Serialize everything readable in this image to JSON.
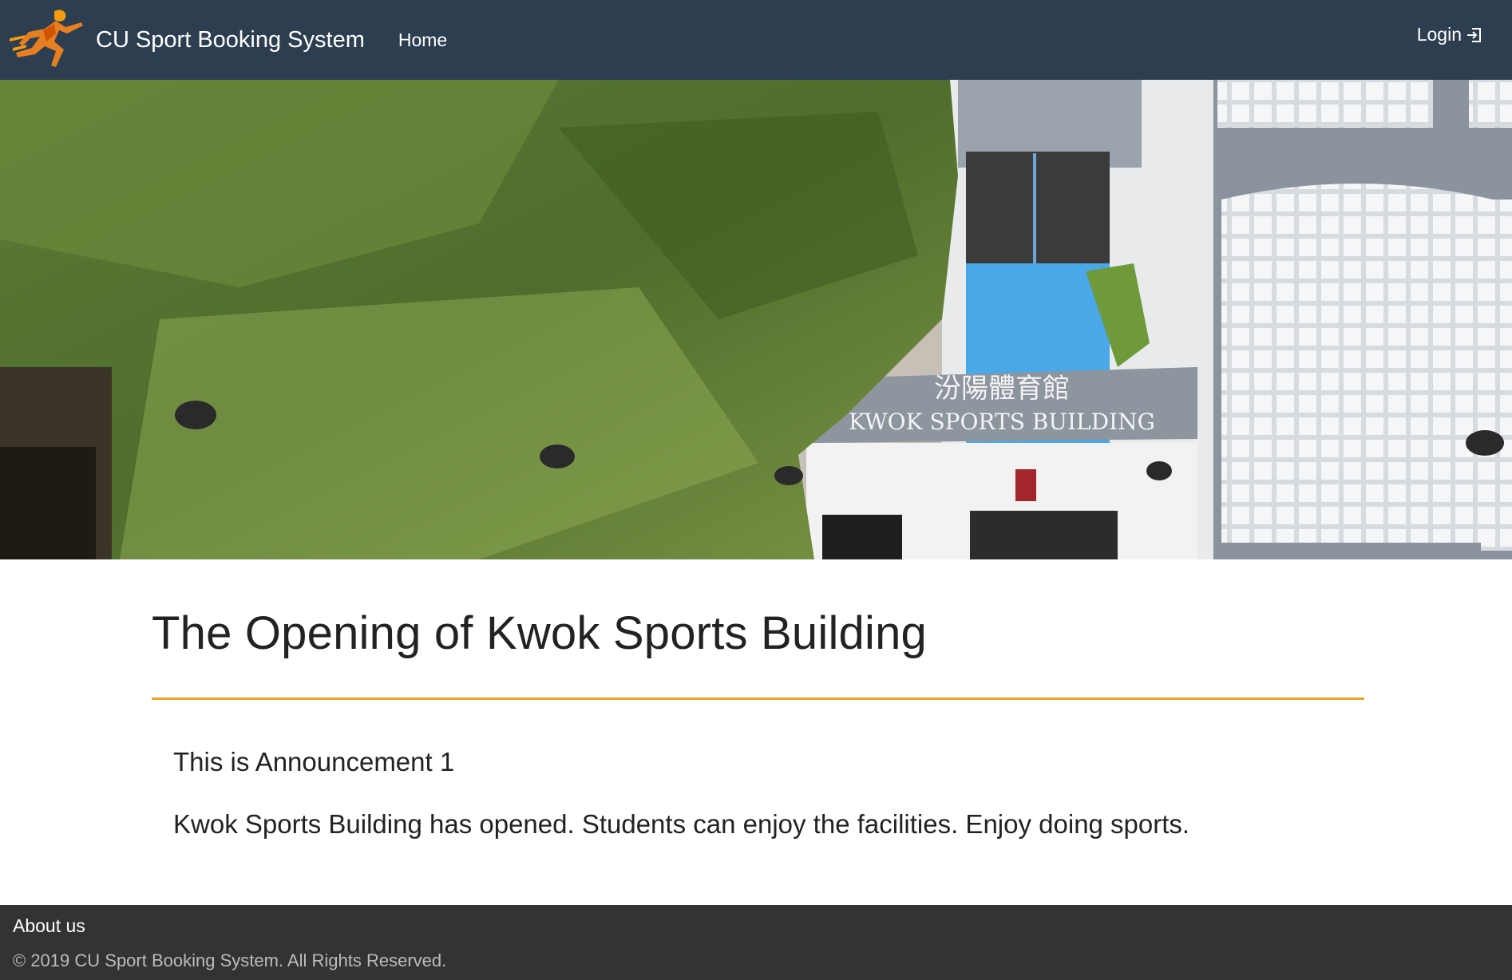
{
  "navbar": {
    "brand_title": "CU Sport Booking System",
    "home_label": "Home",
    "login_label": "Login",
    "login_icon": "sign-in-icon",
    "logo_icon": "running-man-logo"
  },
  "hero": {
    "sign_chinese": "汾陽體育館",
    "sign_english": "KWOK SPORTS BUILDING"
  },
  "announcement": {
    "title": "The Opening of Kwok Sports Building",
    "subtitle": "This is Announcement 1",
    "body": "Kwok Sports Building has opened. Students can enjoy the facilities. Enjoy doing sports."
  },
  "footer": {
    "about_label": "About us",
    "copyright": "© 2019 CU Sport Booking System. All Rights Reserved."
  },
  "colors": {
    "navbar_bg": "#2c3e50",
    "accent_rule": "#f0a51f",
    "footer_bg": "#333333"
  }
}
